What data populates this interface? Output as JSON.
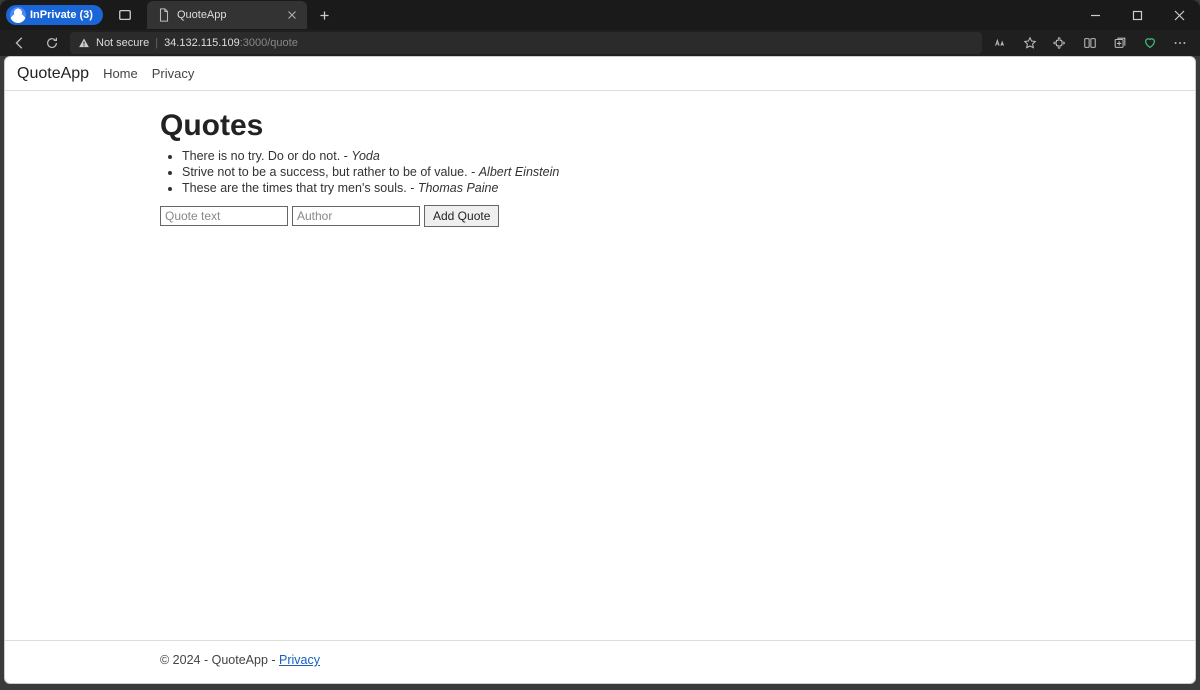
{
  "browser": {
    "inprivate_label": "InPrivate (3)",
    "tab_title": "QuoteApp",
    "url_notsecure": "Not secure",
    "url_host": "34.132.115.109",
    "url_path": ":3000/quote"
  },
  "navbar": {
    "brand": "QuoteApp",
    "links": [
      "Home",
      "Privacy"
    ]
  },
  "page": {
    "heading": "Quotes",
    "quotes": [
      {
        "text": "There is no try. Do or do not.",
        "author": "Yoda"
      },
      {
        "text": "Strive not to be a success, but rather to be of value.",
        "author": "Albert Einstein"
      },
      {
        "text": "These are the times that try men's souls.",
        "author": "Thomas Paine"
      }
    ],
    "form": {
      "quote_placeholder": "Quote text",
      "author_placeholder": "Author",
      "submit_label": "Add Quote"
    }
  },
  "footer": {
    "copyright": "© 2024 - QuoteApp - ",
    "privacy_label": "Privacy"
  }
}
